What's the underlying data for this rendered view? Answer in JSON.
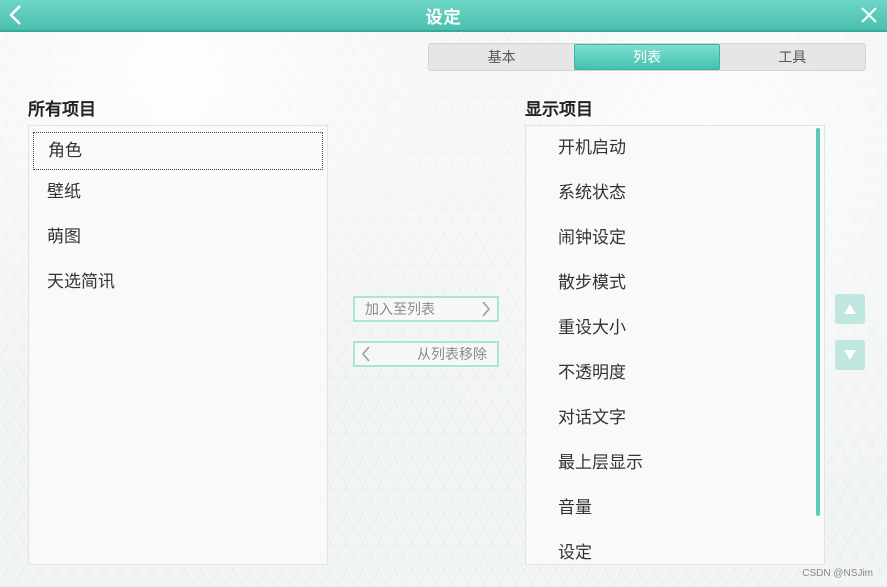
{
  "window": {
    "title": "设定",
    "back_icon": "chevron-left-icon",
    "close_icon": "close-icon"
  },
  "tabs": [
    {
      "label": "基本",
      "active": false
    },
    {
      "label": "列表",
      "active": true
    },
    {
      "label": "工具",
      "active": false
    }
  ],
  "all_items": {
    "heading": "所有项目",
    "items": [
      "角色",
      "壁纸",
      "萌图",
      "天选简讯"
    ],
    "selected_index": 0
  },
  "display_items": {
    "heading": "显示项目",
    "items": [
      "开机启动",
      "系统状态",
      "闹钟设定",
      "散步模式",
      "重设大小",
      "不透明度",
      "对话文字",
      "最上层显示",
      "音量",
      "设定"
    ]
  },
  "actions": {
    "add_label": "加入至列表",
    "remove_label": "从列表移除"
  },
  "order_buttons": {
    "up_icon": "triangle-up-icon",
    "down_icon": "triangle-down-icon"
  },
  "watermark": "CSDN @NSJim",
  "colors": {
    "accent": "#4bbfae",
    "accent_light": "#aee3d9"
  }
}
